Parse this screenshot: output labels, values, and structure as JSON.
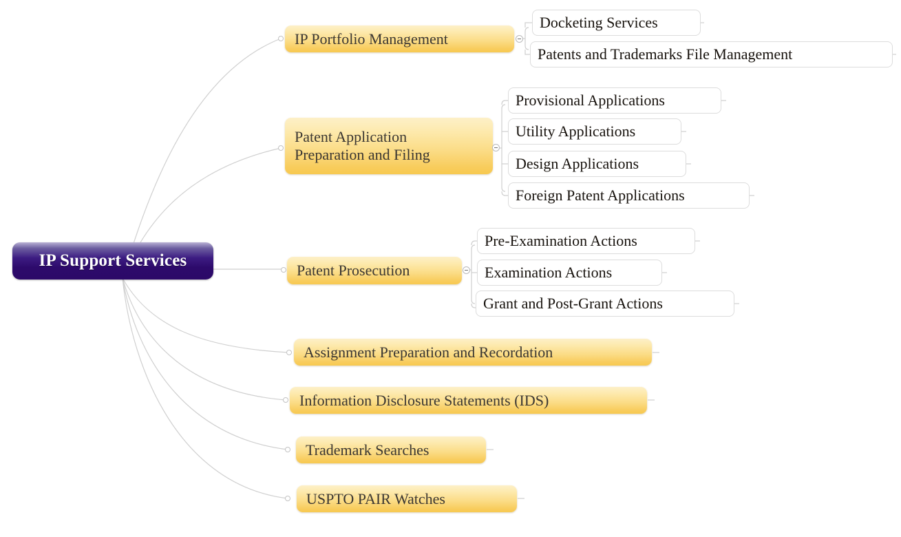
{
  "diagram": {
    "type": "mindmap",
    "title": "IP Support Services",
    "background": "#ffffff",
    "colors": {
      "root_fill_top": "#b9b1d4",
      "root_fill_bottom": "#2c0968",
      "root_text": "#ffffff",
      "branch_fill_top": "#fdf0c8",
      "branch_fill_bottom": "#f7c950",
      "branch_text": "#3a3632",
      "leaf_fill": "#ffffff",
      "leaf_border": "#dcdcdc",
      "leaf_text": "#16110c",
      "connector": "#cfcfcf"
    }
  },
  "root": {
    "label": "IP Support Services"
  },
  "branches": [
    {
      "label": "IP Portfolio Management",
      "has_toggle": true,
      "children": [
        {
          "label": "Docketing Services"
        },
        {
          "label": "Patents and Trademarks File Management"
        }
      ]
    },
    {
      "label": "Patent Application\nPreparation and Filing",
      "has_toggle": true,
      "children": [
        {
          "label": "Provisional Applications"
        },
        {
          "label": "Utility Applications"
        },
        {
          "label": "Design Applications"
        },
        {
          "label": "Foreign Patent Applications"
        }
      ]
    },
    {
      "label": "Patent Prosecution",
      "has_toggle": true,
      "children": [
        {
          "label": "Pre-Examination Actions"
        },
        {
          "label": "Examination Actions"
        },
        {
          "label": "Grant and Post-Grant Actions"
        }
      ]
    },
    {
      "label": "Assignment Preparation and Recordation",
      "has_toggle": false,
      "children": []
    },
    {
      "label": "Information Disclosure Statements (IDS)",
      "has_toggle": false,
      "children": []
    },
    {
      "label": "Trademark Searches",
      "has_toggle": false,
      "children": []
    },
    {
      "label": "USPTO PAIR Watches",
      "has_toggle": false,
      "children": []
    }
  ]
}
